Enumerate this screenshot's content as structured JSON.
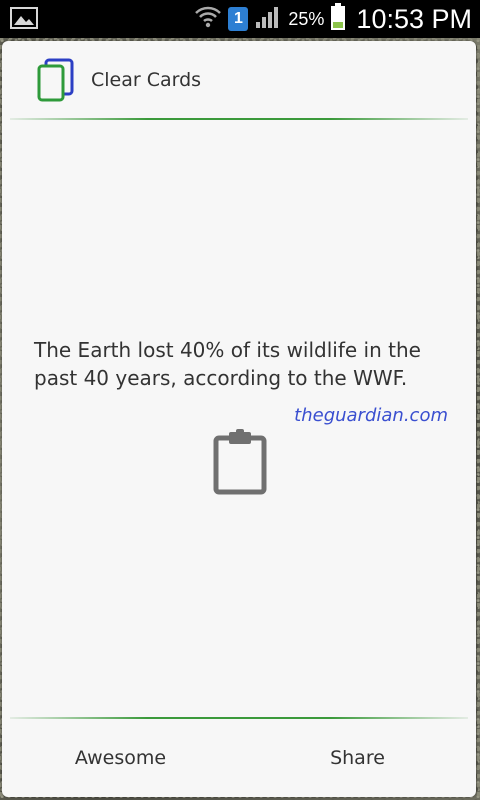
{
  "status_bar": {
    "battery_percent": "25%",
    "sim_slot": "1",
    "time": "10:53 PM",
    "icons": [
      "gallery-notification-icon",
      "wifi-icon",
      "sim-icon",
      "signal-icon",
      "battery-icon"
    ]
  },
  "dialog": {
    "app_title": "Clear Cards",
    "app_icon": "cards-icon",
    "accent_color": "#3b9a3b",
    "fact_text": "The Earth lost 40% of its wildlife in the past 40 years, according to the WWF.",
    "source": "theguardian.com",
    "source_color": "#3a4fd0",
    "copy_icon": "clipboard-icon",
    "actions": {
      "awesome_label": "Awesome",
      "share_label": "Share"
    }
  }
}
